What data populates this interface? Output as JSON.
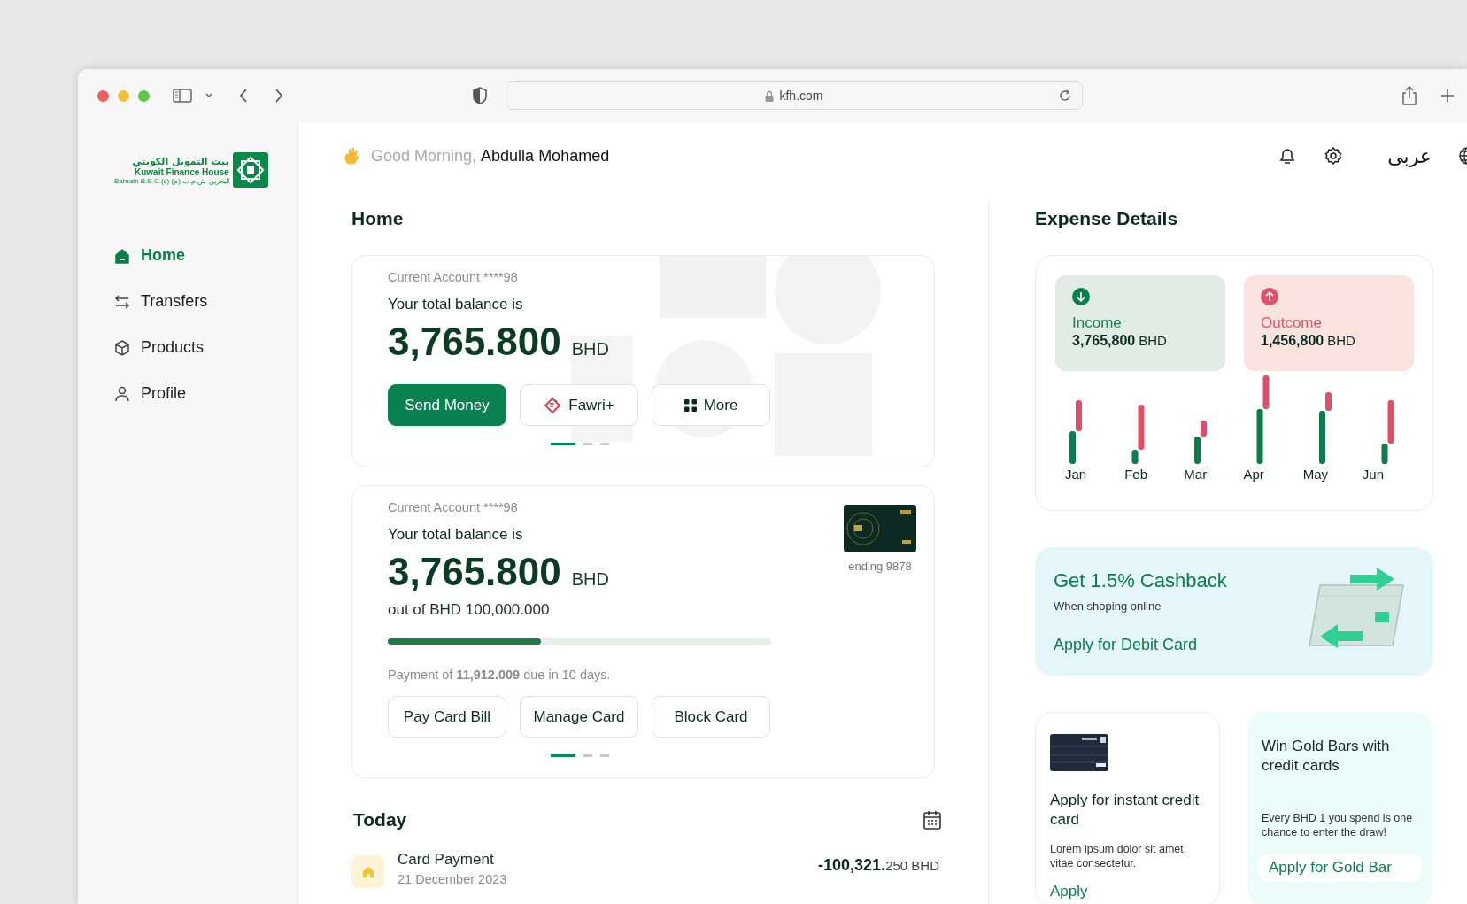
{
  "browser": {
    "url": "kfh.com"
  },
  "logo": {
    "arabic": "بيت التمويل الكويتي",
    "english": "Kuwait Finance House",
    "subtitle": "Bahrain B.S.C.(c) البحرين ش.م.ب (م)"
  },
  "sidebar": {
    "items": [
      {
        "label": "Home",
        "kind": "home",
        "selected": true
      },
      {
        "label": "Transfers",
        "kind": "transfers",
        "selected": false
      },
      {
        "label": "Products",
        "kind": "products",
        "selected": false
      },
      {
        "label": "Profile",
        "kind": "profile",
        "selected": false
      }
    ]
  },
  "header": {
    "greeting": "Good Morning,",
    "name": "Abdulla Mohamed",
    "language": "عربى"
  },
  "home": {
    "title": "Home",
    "accounts": [
      {
        "kind": "balance",
        "account": "Current Account ****98",
        "caption": "Your total balance is",
        "amount": "3,765.800",
        "currency": "BHD",
        "actions": [
          {
            "label": "Send Money",
            "kind": "primary"
          },
          {
            "label": "Fawri+",
            "kind": "fawri"
          },
          {
            "label": "More",
            "kind": "more"
          }
        ],
        "pager": [
          {
            "selected": true
          },
          {
            "selected": false
          },
          {
            "selected": false
          }
        ]
      },
      {
        "kind": "credit",
        "account": "Current Account ****98",
        "caption": "Your total balance is",
        "amount": "3,765.800",
        "currency": "BHD",
        "card_caption": "ending 9878",
        "limit": "out of BHD 100,000.000",
        "level": 0.4,
        "payment": "Payment of **11,912.009** due in 10 days.",
        "actions": [
          {
            "label": "Pay Card Bill",
            "kind": "plain"
          },
          {
            "label": "Manage Card",
            "kind": "plain"
          },
          {
            "label": "Block Card",
            "kind": "plain"
          }
        ],
        "pager": [
          {
            "selected": true
          },
          {
            "selected": false
          },
          {
            "selected": false
          }
        ]
      }
    ]
  },
  "today": {
    "title": "Today",
    "transactions": [
      {
        "title": "Card Payment",
        "date": "21 December 2023",
        "amount": "-100,321.",
        "decimals": "250 BHD"
      }
    ]
  },
  "expenses": {
    "title": "Expense Details",
    "summary": [
      {
        "kind": "income",
        "label": "Income",
        "amount": "3,765,800",
        "currency": "BHD"
      },
      {
        "kind": "outcome",
        "label": "Outcome",
        "amount": "1,456,800",
        "currency": "BHD"
      }
    ],
    "months": [
      "Jan",
      "Feb",
      "Mar",
      "Apr",
      "May",
      "Jun"
    ]
  },
  "promos": [
    {
      "kind": "cashback",
      "title": "Get 1.5% Cashback",
      "text": "When shoping online",
      "link": "Apply for Debit Card"
    },
    {
      "kind": "card",
      "title": "Apply for instant credit card",
      "text": "Lorem ipsum dolor sit amet, vitae consectetur.",
      "link": "Apply"
    },
    {
      "kind": "gold",
      "title": "Win Gold Bars with credit cards",
      "text": "Every BHD 1 you spend is one chance to enter the draw!",
      "link": "Apply for Gold Bar"
    }
  ]
}
